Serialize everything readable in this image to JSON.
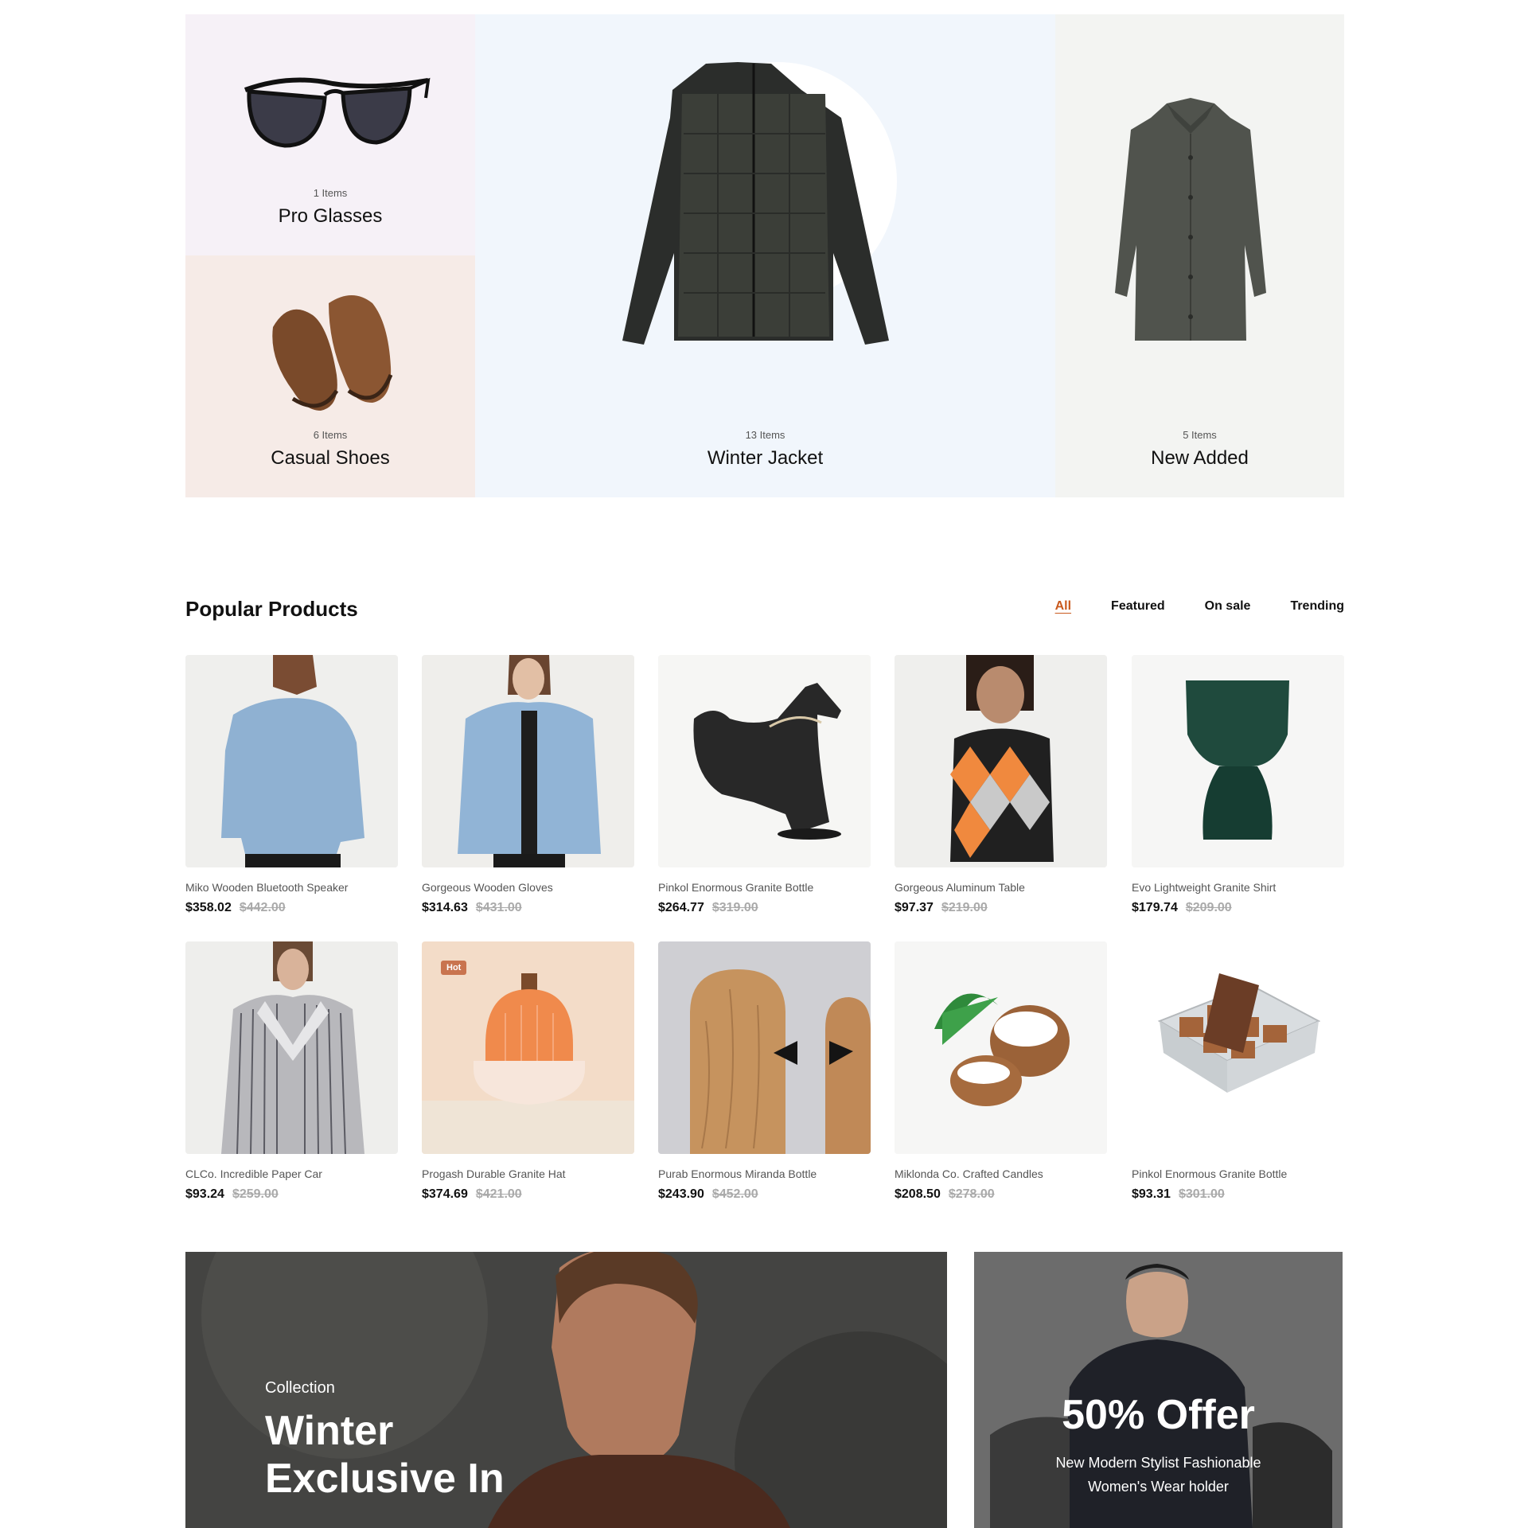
{
  "categories": [
    {
      "count": "1 Items",
      "name": "Pro Glasses",
      "icon": "sunglasses-image"
    },
    {
      "count": "6 Items",
      "name": "Casual Shoes",
      "icon": "shoes-image"
    },
    {
      "count": "13 Items",
      "name": "Winter Jacket",
      "icon": "jacket-image"
    },
    {
      "count": "5 Items",
      "name": "New Added",
      "icon": "coat-image"
    }
  ],
  "popular": {
    "title": "Popular Products",
    "filters": [
      "All",
      "Featured",
      "On sale",
      "Trending"
    ],
    "active_filter": "All"
  },
  "products": [
    {
      "name": "Miko Wooden Bluetooth Speaker",
      "price": "$358.02",
      "old": "$442.00"
    },
    {
      "name": "Gorgeous Wooden Gloves",
      "price": "$314.63",
      "old": "$431.00"
    },
    {
      "name": "Pinkol Enormous Granite Bottle",
      "price": "$264.77",
      "old": "$319.00"
    },
    {
      "name": "Gorgeous Aluminum Table",
      "price": "$97.37",
      "old": "$219.00"
    },
    {
      "name": "Evo Lightweight Granite Shirt",
      "price": "$179.74",
      "old": "$209.00"
    },
    {
      "name": "CLCo. Incredible Paper Car",
      "price": "$93.24",
      "old": "$259.00"
    },
    {
      "name": "Progash Durable Granite Hat",
      "price": "$374.69",
      "old": "$421.00",
      "badge": "Hot"
    },
    {
      "name": "Purab Enormous Miranda Bottle",
      "price": "$243.90",
      "old": "$452.00"
    },
    {
      "name": "Miklonda Co. Crafted Candles",
      "price": "$208.50",
      "old": "$278.00"
    },
    {
      "name": "Pinkol Enormous Granite Bottle",
      "price": "$93.31",
      "old": "$301.00"
    }
  ],
  "banner_left": {
    "kicker": "Collection",
    "title_line1": "Winter",
    "title_line2": "Exclusive In"
  },
  "banner_right": {
    "title": "50% Offer",
    "line1": "New Modern Stylist Fashionable",
    "line2": "Women's Wear holder"
  },
  "colors": {
    "accent": "#c95a1e",
    "badge": "#c9744f"
  }
}
